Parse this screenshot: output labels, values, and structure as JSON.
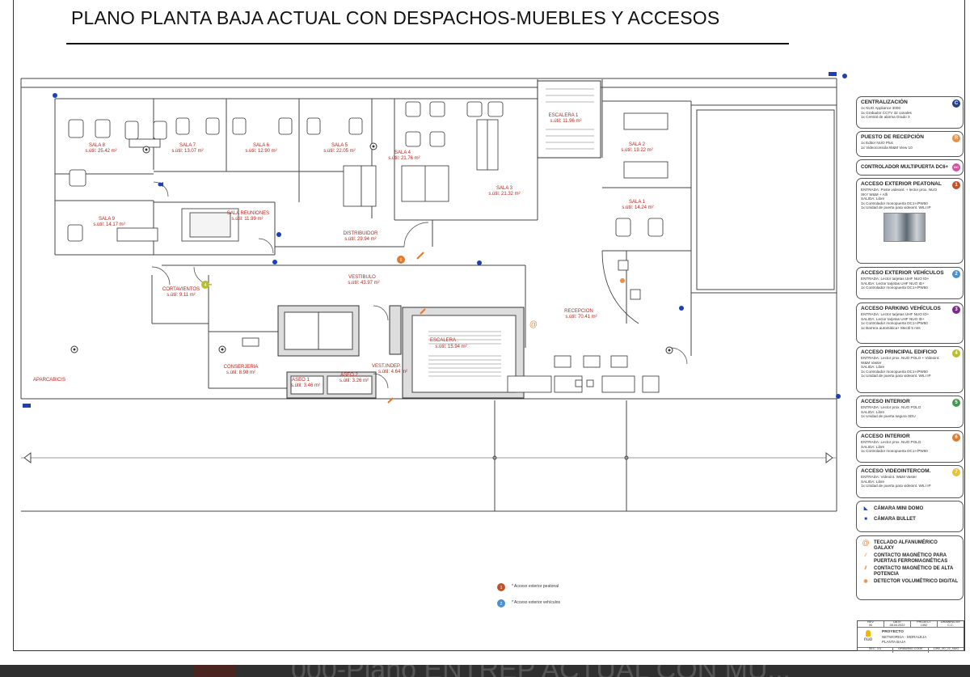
{
  "title": "PLANO PLANTA BAJA ACTUAL CON DESPACHOS-MUEBLES Y ACCESOS",
  "rooms": {
    "sala8": {
      "name": "SALA 8",
      "area": "s.útil: 25.42 m²"
    },
    "sala7": {
      "name": "SALA 7",
      "area": "s.útil: 13.07 m²"
    },
    "sala6": {
      "name": "SALA 6",
      "area": "s.útil: 12.90 m²"
    },
    "sala5": {
      "name": "SALA 5",
      "area": "s.útil: 22.05 m²"
    },
    "sala4": {
      "name": "SALA 4",
      "area": "s.útil: 21.76 m²"
    },
    "sala3": {
      "name": "SALA 3",
      "area": "s.útil: 21.32 m²"
    },
    "sala2": {
      "name": "SALA 2",
      "area": "s.útil: 19.22 m²"
    },
    "sala1": {
      "name": "SALA 1",
      "area": "s.útil: 14.24 m²"
    },
    "sala9": {
      "name": "SALA 9",
      "area": "s.útil: 14.17 m²"
    },
    "reuniones": {
      "name": "SALA REUNIONES",
      "area": "s.útil: 11.99 m²"
    },
    "distribuidor": {
      "name": "DISTRIBUIDOR",
      "area": "s.útil: 29.94 m²"
    },
    "vestibulo": {
      "name": "VESTIBULO",
      "area": "s.útil: 43.97 m²"
    },
    "escalera1": {
      "name": "ESCALERA 1",
      "area": "s.útil: 11.96 m²"
    },
    "recepcion": {
      "name": "RECEPCION",
      "area": "s.útil: 70.41 m²"
    },
    "cortavientos": {
      "name": "CORTAVIENTOS",
      "area": "s.útil: 9.11 m²"
    },
    "conserjeria": {
      "name": "CONSERJERIA",
      "area": "s.útil: 8.98 m²"
    },
    "aseo1": {
      "name": "ASEO 1",
      "area": "s.útil: 3.46 m²"
    },
    "aseo2": {
      "name": "ASEO 2",
      "area": "s.útil: 3.26 m²"
    },
    "vestindep": {
      "name": "VEST.INDEP.",
      "area": "s.útil: 4.64 m²"
    },
    "escalera": {
      "name": "ESCALERA",
      "area": "s.útil: 15.94 m²"
    },
    "aparcabicis": {
      "name": "APARCABICIS"
    }
  },
  "plan_markers": {
    "m1": "1",
    "m4": "4",
    "m6": "6"
  },
  "notes": {
    "note1": {
      "num": "1",
      "text": "* Acceso exterior peatonal",
      "color": "#c0522b"
    },
    "note2": {
      "num": "2",
      "text": "* Acceso exterior vehículos",
      "color": "#4a8fd1"
    }
  },
  "legend": {
    "centralizacion": {
      "title": "CENTRALIZACIÓN",
      "badge": "C",
      "color": "#24418f",
      "lines": [
        "1x NUO Appliance 3000",
        "1x Grabador CCTV 32 canales",
        "1x Central de alarma Grado 3"
      ]
    },
    "recepcion": {
      "title": "PUESTO DE RECEPCIÓN",
      "badge": "R",
      "color": "#e6904a",
      "lines": [
        "1x Editor NUO Plus",
        "1x Videoconsola W&M View 10"
      ]
    },
    "controlador": {
      "title": "CONTROLADOR MULTIPUERTA DC6+",
      "badge": "DC",
      "color": "#d24fa6"
    },
    "peatonal": {
      "title": "ACCESO EXTERIOR PEATONAL",
      "badge": "1",
      "color": "#c0522b",
      "lines": [
        "ENTRADA: Poste videoint. + lector prox.  NUO",
        "SKY W&M + Alfi",
        "SALIDA: Libre",
        "1x Controlador monopuerta DC1+/PW50",
        "1x Unidad de puerta para videoint. WILI IP"
      ]
    },
    "vehiculos": {
      "title": "ACCESO EXTERIOR VEHÍCULOS",
      "badge": "2",
      "color": "#4a8fd1",
      "lines": [
        "ENTRADA: Lector tarjetas UHF NUO ID+",
        "SALIDA: Lector tarjetas UHF NUO ID+",
        "1x Controlador monopuerta DC1+/PW50"
      ]
    },
    "parking": {
      "title": "ACCESO PARKING VEHÍCULOS",
      "badge": "3",
      "color": "#7a2a8c",
      "lines": [
        "ENTRADA: Lector tarjetas UHF NUO ID+",
        "SALIDA: Lector tarjetas UHF NUO ID+",
        "1x Controlador monopuerta DC1+/PW50",
        "1x Barrera automática+  Mectil 5 mts"
      ]
    },
    "principal": {
      "title": "ACCESO PRINCIPAL EDIFICIO",
      "badge": "4",
      "color": "#b8bf2a",
      "lines": [
        "ENTRADA: Lector prox. NUO POLO + Videoint.",
        "W&M Vaster",
        "SALIDA: Libre",
        "1x Controlador monopuerta DC1+/PW50",
        "1x Unidad de puerta para videoint. WILI IP"
      ]
    },
    "interior5": {
      "title": "ACCESO INTERIOR",
      "badge": "5",
      "color": "#3f9a4a",
      "lines": [
        "ENTRADA: Lector prox. NUO POLO",
        "SALIDA: Libre",
        "1x Unidad de puerta segura SDU"
      ]
    },
    "interior6": {
      "title": "ACCESO INTERIOR",
      "badge": "6",
      "color": "#e07a2e",
      "lines": [
        "ENTRADA: Lector prox. NUO POLO",
        "SALIDA: Libre",
        "1x Controlador monopuerta DC1+/PW50"
      ]
    },
    "videointercom": {
      "title": "ACCESO VIDEOINTERCOM.",
      "badge": "7",
      "color": "#e8c23a",
      "lines": [
        "ENTRADA: Videoint. W&M Vaster",
        "SALIDA: Libre",
        "1x Unidad de puerta para videoint. WILI IP"
      ]
    },
    "cameras": {
      "mini": "CÁMARA MINI DOMO",
      "bullet": "CÁMARA BULLET"
    },
    "symbols": {
      "teclado": "TECLADO ALFANUMÉRICO GALAXY",
      "contacto": "CONTACTO MAGNÉTICO PARA PUERTAS FERROMAGNÉTICAS",
      "contacto_alta": "CONTACTO MAGNÉTICO DE ALTA POTENCIA",
      "detector": "DETECTOR VOLUMÉTRICO DIGITAL"
    }
  },
  "titleblock": {
    "rev_label": "REV",
    "date_label": "DATE",
    "project_label": "PROJECT",
    "drawing_label": "DRAWING BY",
    "rev": "00",
    "date": "28.04.2022",
    "project": "1392",
    "drawing": "C.C.",
    "heading": "PROYECTO",
    "name": "NETWORKIA - MORALEJA",
    "plant": "PLANTA BAJA",
    "logo": "nuo",
    "dwg_label": "DRAWING CODE",
    "dwg_code": "1392_00_22_NUO",
    "sec_label": "SEC.",
    "sec": "1/1"
  },
  "footer_text": "000-Plano ENTREP ACTUAL CON MU..."
}
